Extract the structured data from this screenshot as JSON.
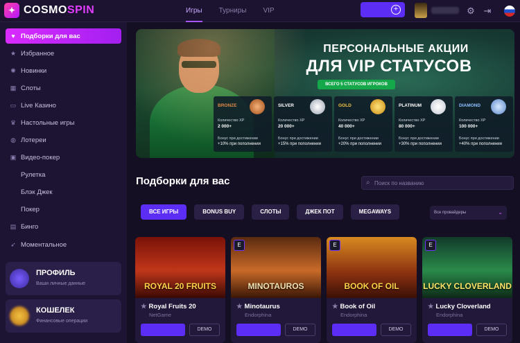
{
  "header": {
    "logo_mark": "✦",
    "logo_left": "COSMO",
    "logo_right": "SPIN",
    "nav": [
      "Игры",
      "Турниры",
      "VIP"
    ],
    "deposit_icon": "plus-circle-icon",
    "icons": [
      "gear-icon",
      "logout-icon",
      "flag-ru-icon"
    ]
  },
  "sidebar": {
    "items": [
      {
        "label": "Подборки для вас",
        "icon": "heart-icon"
      },
      {
        "label": "Избранное",
        "icon": "star-icon"
      },
      {
        "label": "Новинки",
        "icon": "new-icon"
      },
      {
        "label": "Слоты",
        "icon": "slots-icon"
      },
      {
        "label": "Live Казино",
        "icon": "live-icon"
      },
      {
        "label": "Настольные игры",
        "icon": "crown-icon"
      },
      {
        "label": "Лотереи",
        "icon": "lottery-icon"
      },
      {
        "label": "Видео-покер",
        "icon": "videopoker-icon"
      },
      {
        "label": "Рулетка",
        "icon": "roulette-icon"
      },
      {
        "label": "Блэк Джек",
        "icon": "blackjack-icon"
      },
      {
        "label": "Покер",
        "icon": "poker-icon"
      },
      {
        "label": "Бинго",
        "icon": "bingo-icon"
      },
      {
        "label": "Моментальное",
        "icon": "rocket-icon"
      }
    ],
    "cards": [
      {
        "title": "ПРОФИЛЬ",
        "subtitle": "Ваши личные данные"
      },
      {
        "title": "КОШЕЛЕК",
        "subtitle": "Финансовые операции"
      }
    ]
  },
  "banner": {
    "title_line1": "ПЕРСОНАЛЬНЫЕ АКЦИИ",
    "title_line2": "ДЛЯ VIP СТАТУСОВ",
    "tag": "ВСЕГО 5 СТАТУСОВ ИГРОКОВ",
    "tiers": [
      {
        "name": "BRONZE",
        "color": "#e08a48",
        "xp_label": "Количество XP",
        "xp": "2 000+",
        "bonus_label": "Бонус при достижении",
        "bonus": "+10% при пополнении"
      },
      {
        "name": "SILVER",
        "color": "#ffffff",
        "xp_label": "Количество XP",
        "xp": "20 000+",
        "bonus_label": "Бонус при достижении",
        "bonus": "+15% при пополнении"
      },
      {
        "name": "GOLD",
        "color": "#f5c542",
        "xp_label": "Количество XP",
        "xp": "40 000+",
        "bonus_label": "Бонус при достижении",
        "bonus": "+20% при пополнении"
      },
      {
        "name": "PLATINUM",
        "color": "#ffffff",
        "xp_label": "Количество XP",
        "xp": "80 000+",
        "bonus_label": "Бонус при достижении",
        "bonus": "+30% при пополнении"
      },
      {
        "name": "DIAMOND",
        "color": "#8fc0ff",
        "xp_label": "Количество XP",
        "xp": "100 000+",
        "bonus_label": "Бонус при достижении",
        "bonus": "+40% при пополнении"
      }
    ]
  },
  "section": {
    "title": "Подборки для вас",
    "search_placeholder": "Поиск по названию",
    "filters": [
      "ВСЕ ИГРЫ",
      "BONUS BUY",
      "СЛОТЫ",
      "ДЖЕК ПОТ",
      "MEGAWAYS"
    ],
    "provider_select": "Все провайдеры"
  },
  "games": [
    {
      "name": "Royal Fruits 20",
      "provider": "NetGame",
      "thumb_text": "ROYAL 20 FRUITS",
      "bg": "linear-gradient(#7a1208,#c0361a 55%,#3a0a04)",
      "demo": "DEMO",
      "has_e": false
    },
    {
      "name": "Minotaurus",
      "provider": "Endorphina",
      "thumb_text": "MINOTAUROS",
      "bg": "linear-gradient(#5a2a10,#c96a28 55%,#3a1606)",
      "demo": "DEMO",
      "has_e": true
    },
    {
      "name": "Book of Oil",
      "provider": "Endorphina",
      "thumb_text": "BOOK OF OIL",
      "bg": "linear-gradient(#d88a20,#8a3010 60%,#3a1006)",
      "demo": "DEMO",
      "has_e": true
    },
    {
      "name": "Lucky Cloverland",
      "provider": "Endorphina",
      "thumb_text": "LUCKY CLOVERLAND",
      "bg": "linear-gradient(#123a2a,#2a8a4a 55%,#0e2a18)",
      "demo": "DEMO",
      "has_e": true
    }
  ]
}
